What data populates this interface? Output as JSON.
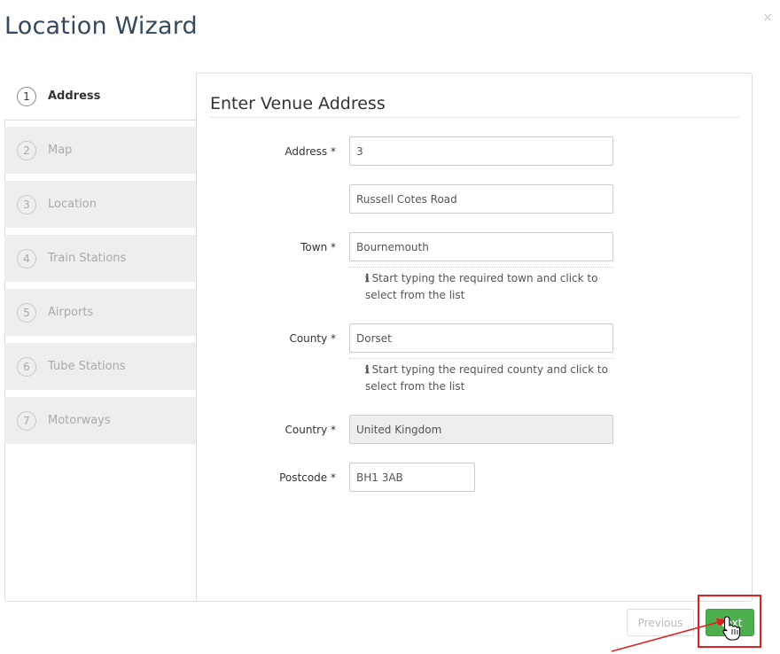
{
  "modal": {
    "title": "Location Wizard",
    "close_glyph": "×"
  },
  "steps": [
    {
      "num": "1",
      "label": "Address",
      "active": true
    },
    {
      "num": "2",
      "label": "Map"
    },
    {
      "num": "3",
      "label": "Location"
    },
    {
      "num": "4",
      "label": "Train Stations"
    },
    {
      "num": "5",
      "label": "Airports"
    },
    {
      "num": "6",
      "label": "Tube Stations"
    },
    {
      "num": "7",
      "label": "Motorways"
    }
  ],
  "form": {
    "section_title": "Enter Venue Address",
    "address_label": "Address *",
    "address_line1": "3",
    "address_line2": "Russell Cotes Road",
    "town_label": "Town *",
    "town_value": "Bournemouth",
    "town_help": "Start typing the required town and click to select from the list",
    "county_label": "County *",
    "county_value": "Dorset",
    "county_help": "Start typing the required county and click to select from the list",
    "country_label": "Country *",
    "country_value": "United Kingdom",
    "postcode_label": "Postcode *",
    "postcode_value": "BH1 3AB",
    "info_glyph": "ℹ"
  },
  "footer": {
    "previous_label": "Previous",
    "next_label": "Next"
  },
  "colors": {
    "title": "#34495e",
    "next_button": "#4cae4c",
    "annotation": "#e02020"
  },
  "icons": {
    "close": "close-icon",
    "info": "info-icon",
    "cursor": "hand-pointer-icon",
    "annotation_arrow": "red-arrow-annotation"
  }
}
